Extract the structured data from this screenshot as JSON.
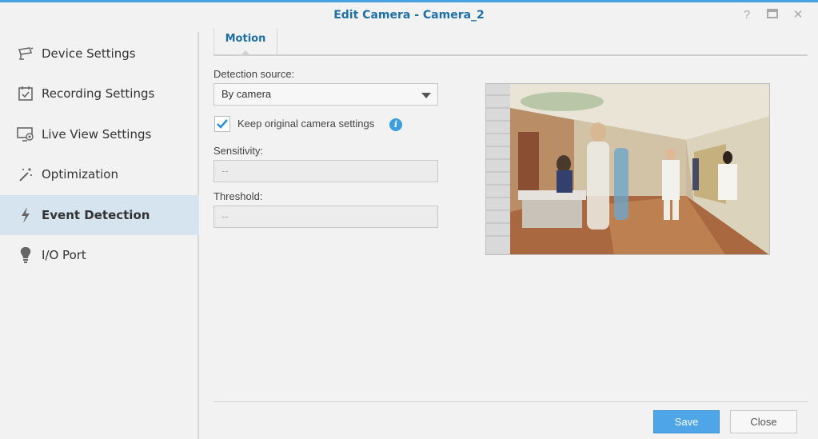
{
  "window": {
    "title": "Edit Camera - Camera_2",
    "help_icon": "?",
    "maximize_icon": "□",
    "close_icon": "✕"
  },
  "sidebar": {
    "items": [
      {
        "label": "Device Settings",
        "icon": "camera-icon"
      },
      {
        "label": "Recording Settings",
        "icon": "calendar-check-icon"
      },
      {
        "label": "Live View Settings",
        "icon": "monitor-icon"
      },
      {
        "label": "Optimization",
        "icon": "magic-wand-icon"
      },
      {
        "label": "Event Detection",
        "icon": "lightning-icon",
        "active": true
      },
      {
        "label": "I/O Port",
        "icon": "lightbulb-icon"
      }
    ]
  },
  "tabs": [
    {
      "label": "Motion",
      "active": true
    }
  ],
  "form": {
    "detection_source_label": "Detection source:",
    "detection_source_value": "By camera",
    "keep_settings_label": "Keep original camera settings",
    "keep_settings_checked": true,
    "sensitivity_label": "Sensitivity:",
    "sensitivity_value": "--",
    "threshold_label": "Threshold:",
    "threshold_value": "--"
  },
  "footer": {
    "save_label": "Save",
    "close_label": "Close"
  },
  "colors": {
    "accent": "#1d6fa5",
    "primary_button": "#4ea6e8",
    "active_nav": "#d5e4ef"
  }
}
